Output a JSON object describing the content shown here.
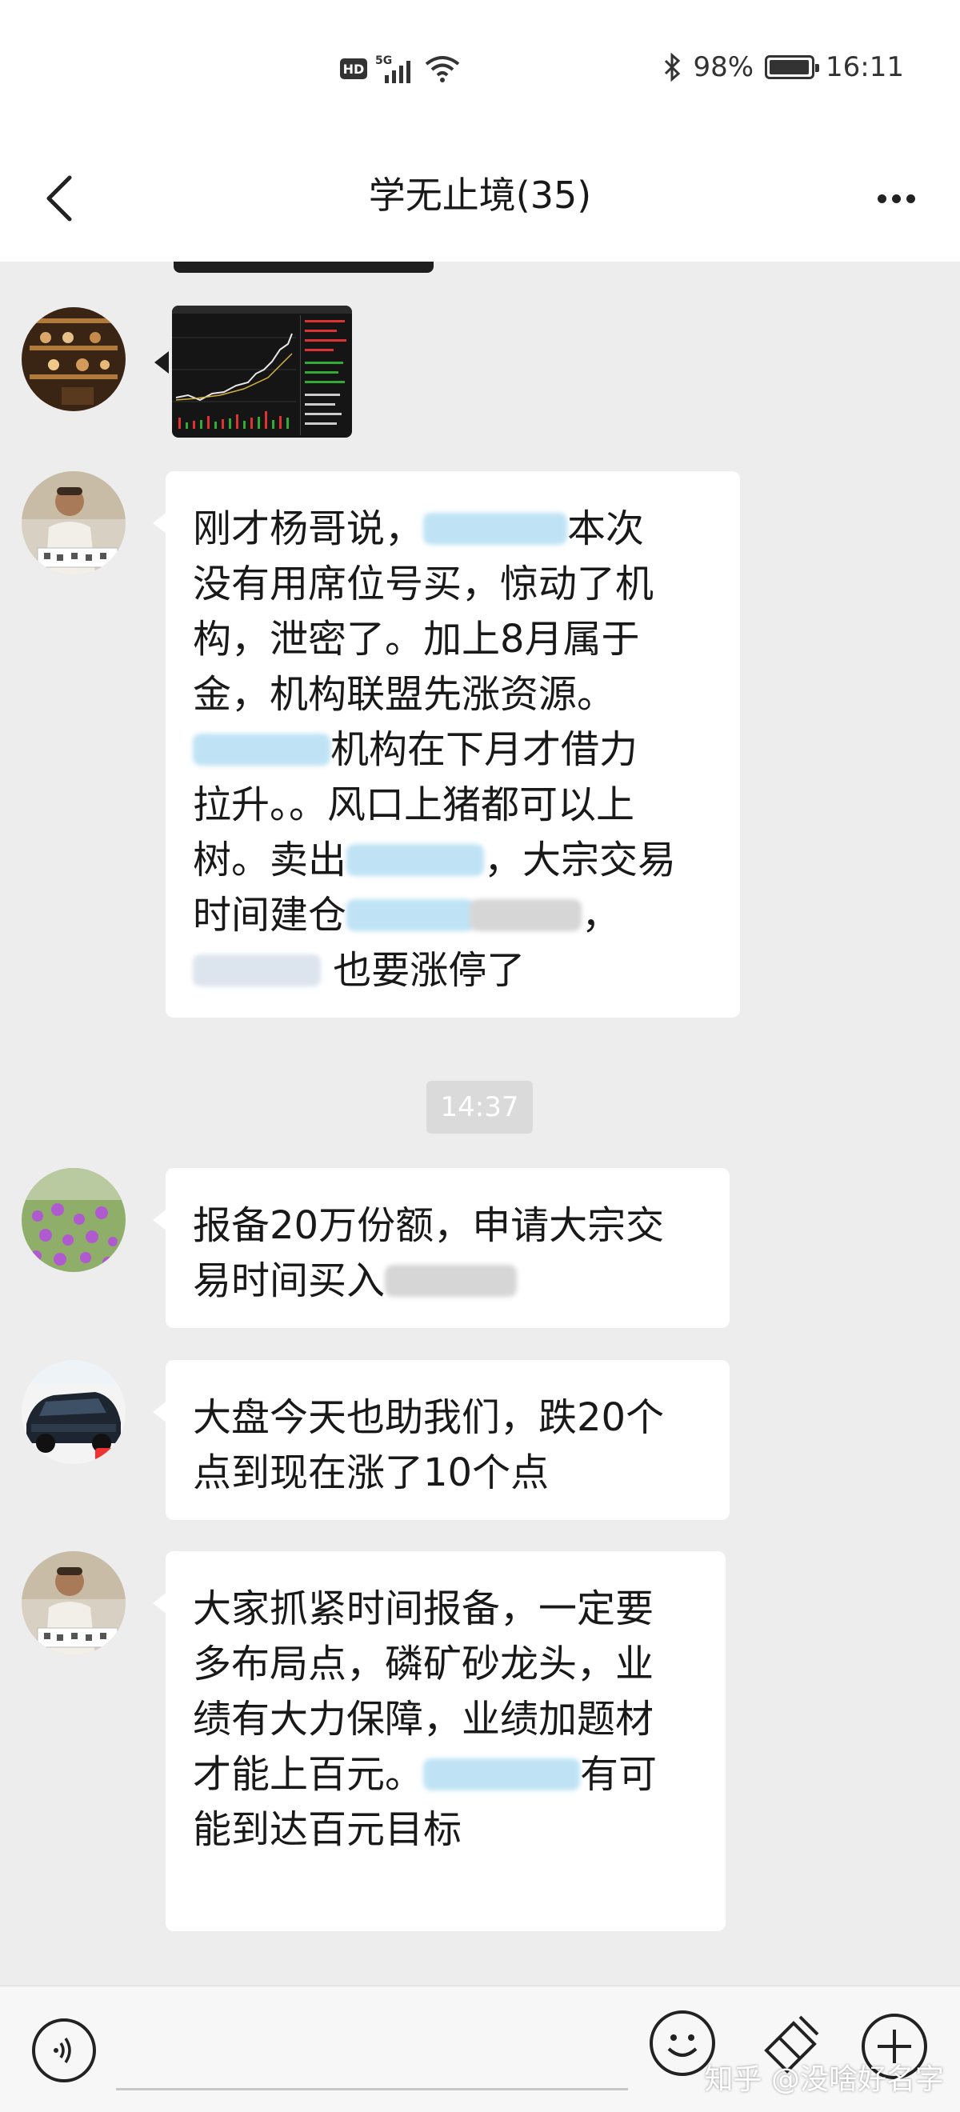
{
  "status_bar": {
    "hd_label": "HD",
    "network_label": "5G",
    "battery_text": "98%",
    "battery_level": 0.98,
    "time": "16:11"
  },
  "header": {
    "title": "学无止境(35)",
    "back_icon": "chevron-left-icon",
    "more_icon": "more-horizontal-icon"
  },
  "messages": [
    {
      "type": "image",
      "content": "stock-chart-thumbnail"
    },
    {
      "type": "text",
      "lines": [
        [
          "刚才杨哥说，",
          "[blur]",
          "本次"
        ],
        [
          "没有用席位号买，惊动了机"
        ],
        [
          "构，泄密了。加上8月属于"
        ],
        [
          "金，机构联盟先涨资源。"
        ],
        [
          "[blur]",
          "机构在下月才借力"
        ],
        [
          "拉升。。风口上猪都可以上"
        ],
        [
          "树。卖出",
          "[blur]",
          "，大宗交易"
        ],
        [
          "时间建仓",
          "[blur]",
          "，"
        ],
        [
          "[blur]",
          " 也要涨停了"
        ]
      ]
    },
    {
      "type": "time",
      "text": "14:37"
    },
    {
      "type": "text",
      "lines": [
        [
          "报备20万份额，申请大宗交"
        ],
        [
          "易时间买入",
          "[blur]"
        ]
      ]
    },
    {
      "type": "text",
      "lines": [
        [
          "大盘今天也助我们，跌20个"
        ],
        [
          "点到现在涨了10个点"
        ]
      ]
    },
    {
      "type": "text",
      "lines": [
        [
          "大家抓紧时间报备，一定要"
        ],
        [
          "多布局点，磷矿砂龙头，业"
        ],
        [
          "绩有大力保障，业绩加题材"
        ],
        [
          "才能上百元。",
          "[blur]",
          "有可"
        ],
        [
          "能到达百元目标"
        ]
      ]
    }
  ],
  "input_bar": {
    "voice_icon": "voice-icon",
    "emoji_icon": "emoji-icon",
    "tool_icon": "eraser-icon",
    "plus_icon": "plus-icon"
  },
  "watermark": "知乎 @没啥好名字"
}
